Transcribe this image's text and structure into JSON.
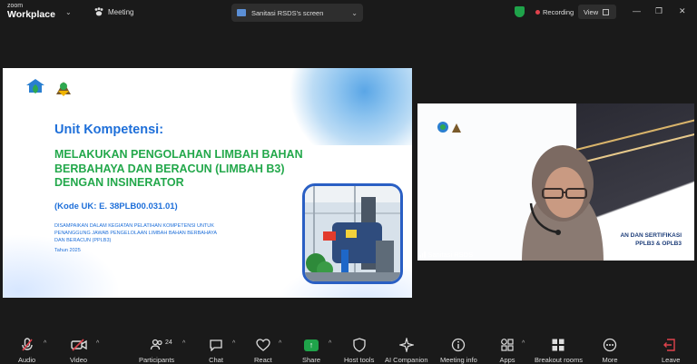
{
  "app": {
    "brand_small": "zoom",
    "brand_big": "Workplace",
    "meeting_label": "Meeting"
  },
  "screen_share": {
    "label": "Sanitasi RSDS's screen"
  },
  "status": {
    "recording": "Recording",
    "view": "View"
  },
  "slide": {
    "title": "Unit Kompetensi:",
    "subtitle_lines": [
      "MELAKUKAN PENGOLAHAN LIMBAH BAHAN",
      "BERBAHAYA DAN BERACUN (LIMBAH B3)",
      "DENGAN INSINERATOR"
    ],
    "code": "(Kode UK: E. 38PLB00.031.01)",
    "desc_lines": [
      "DISAMPAIKAN DALAM KEGIATAN PELATIHAN KOMPETENSI UNTUK",
      "PENANGGUNG JAWAB PENGELOLAAN LIMBAH BAHAN BERBAHAYA",
      "DAN BERACUN (PPLB3)"
    ],
    "year": "Tahun 2025"
  },
  "speaker": {
    "name": "Sanitasi RSDS",
    "bg_text_1": "AN DAN SERTIFIKASI",
    "bg_text_2": "PPLB3 & OPLB3"
  },
  "toolbar": {
    "audio": "Audio",
    "video": "Video",
    "participants": "Participants",
    "participants_count": "24",
    "chat": "Chat",
    "react": "React",
    "share": "Share",
    "host_tools": "Host tools",
    "ai_companion": "AI Companion",
    "meeting_info": "Meeting info",
    "apps": "Apps",
    "breakout_rooms": "Breakout rooms",
    "more": "More",
    "leave": "Leave"
  },
  "colors": {
    "share_green": "#1fa34a",
    "leave_red": "#e0424c",
    "record_red": "#e0424c",
    "slide_blue": "#1e6fd9",
    "slide_green": "#23a84b"
  }
}
